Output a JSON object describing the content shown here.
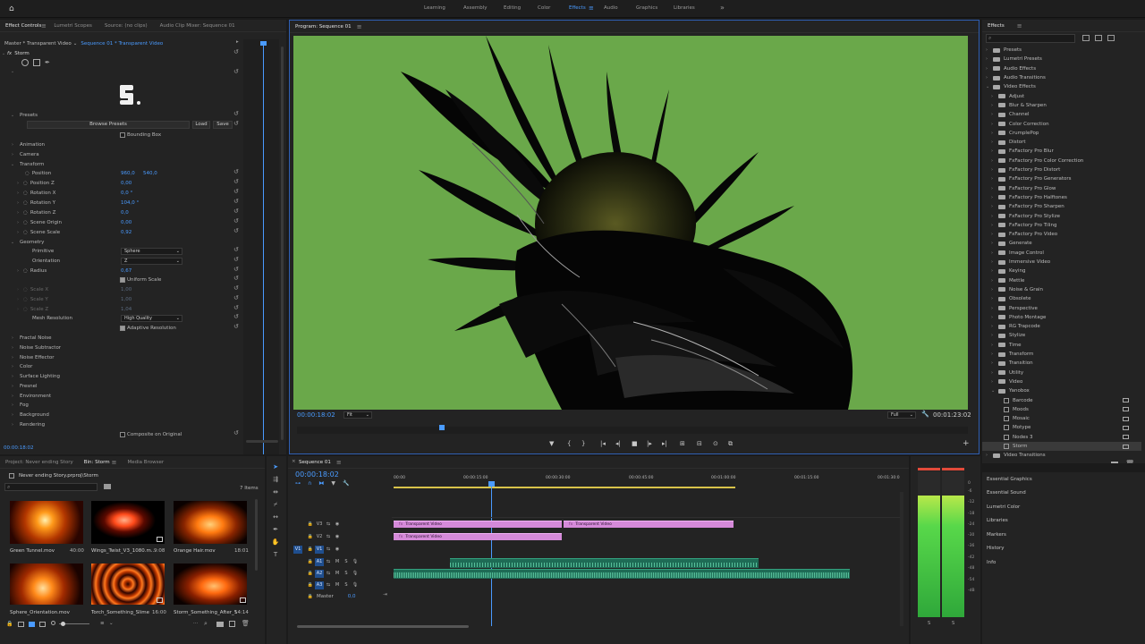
{
  "workspaces": [
    "Learning",
    "Assembly",
    "Editing",
    "Color",
    "Effects",
    "Audio",
    "Graphics",
    "Libraries"
  ],
  "workspaces_overflow": "»",
  "effect_controls": {
    "tabs": [
      "Effect Controls",
      "Lumetri Scopes",
      "Source: (no clips)",
      "Audio Clip Mixer: Sequence 01"
    ],
    "hamb": "≡",
    "master_label": "Master * Transparent Video",
    "sequence_label": "Sequence 01 * Transparent Video",
    "fx_label": "fx",
    "effect_name": "Storm",
    "presets_label": "Presets",
    "browse_presets": "Browse Presets",
    "load": "Load",
    "save": "Save",
    "bounding_box": "Bounding Box",
    "animation": "Animation",
    "camera": "Camera",
    "transform": "Transform",
    "position": "Position",
    "position_x": "960,0",
    "position_y": "540,0",
    "position_z": "Position Z",
    "position_z_val": "0,00",
    "rotation_x": "Rotation X",
    "rotation_x_val": "0,0 °",
    "rotation_y": "Rotation Y",
    "rotation_y_val": "104,0 °",
    "rotation_z": "Rotation Z",
    "rotation_z_val": "0,0",
    "scene_origin": "Scene Origin",
    "scene_origin_val": "0,00",
    "scene_scale": "Scene Scale",
    "scene_scale_val": "0,92",
    "geometry": "Geometry",
    "primitive": "Primitive",
    "primitive_val": "Sphere",
    "orientation": "Orientation",
    "orientation_val": "Z",
    "radius": "Radius",
    "radius_val": "0,67",
    "uniform_scale": "Uniform Scale",
    "scale_x": "Scale X",
    "scale_x_val": "1,00",
    "scale_y": "Scale Y",
    "scale_y_val": "1,00",
    "scale_z": "Scale Z",
    "scale_z_val": "1,04",
    "mesh_resolution": "Mesh Resolution",
    "mesh_resolution_val": "High Quality",
    "adaptive_resolution": "Adaptive Resolution",
    "groups": [
      "Fractal Noise",
      "Noise Subtractor",
      "Noise Effector",
      "Color",
      "Surface Lighting",
      "Fresnel",
      "Environment",
      "Fog",
      "Background",
      "Rendering"
    ],
    "composite": "Composite on Original",
    "timecode": "00:00:18:02"
  },
  "program": {
    "title": "Program: Sequence 01",
    "timecode": "00:00:18:02",
    "fit": "Fit",
    "quality": "Full",
    "duration": "00:01:23:02"
  },
  "effects_panel": {
    "title": "Effects",
    "items": [
      {
        "label": "Presets",
        "level": 0,
        "kind": "folder",
        "open": false
      },
      {
        "label": "Lumetri Presets",
        "level": 0,
        "kind": "folder",
        "open": false
      },
      {
        "label": "Audio Effects",
        "level": 0,
        "kind": "folder",
        "open": false
      },
      {
        "label": "Audio Transitions",
        "level": 0,
        "kind": "folder",
        "open": false
      },
      {
        "label": "Video Effects",
        "level": 0,
        "kind": "folder",
        "open": true
      },
      {
        "label": "Adjust",
        "level": 1,
        "kind": "folder",
        "open": false
      },
      {
        "label": "Blur & Sharpen",
        "level": 1,
        "kind": "folder",
        "open": false
      },
      {
        "label": "Channel",
        "level": 1,
        "kind": "folder",
        "open": false
      },
      {
        "label": "Color Correction",
        "level": 1,
        "kind": "folder",
        "open": false
      },
      {
        "label": "CrumplePop",
        "level": 1,
        "kind": "folder",
        "open": false
      },
      {
        "label": "Distort",
        "level": 1,
        "kind": "folder",
        "open": false
      },
      {
        "label": "FxFactory Pro Blur",
        "level": 1,
        "kind": "folder",
        "open": false
      },
      {
        "label": "FxFactory Pro Color Correction",
        "level": 1,
        "kind": "folder",
        "open": false
      },
      {
        "label": "FxFactory Pro Distort",
        "level": 1,
        "kind": "folder",
        "open": false
      },
      {
        "label": "FxFactory Pro Generators",
        "level": 1,
        "kind": "folder",
        "open": false
      },
      {
        "label": "FxFactory Pro Glow",
        "level": 1,
        "kind": "folder",
        "open": false
      },
      {
        "label": "FxFactory Pro Halftones",
        "level": 1,
        "kind": "folder",
        "open": false
      },
      {
        "label": "FxFactory Pro Sharpen",
        "level": 1,
        "kind": "folder",
        "open": false
      },
      {
        "label": "FxFactory Pro Stylize",
        "level": 1,
        "kind": "folder",
        "open": false
      },
      {
        "label": "FxFactory Pro Tiling",
        "level": 1,
        "kind": "folder",
        "open": false
      },
      {
        "label": "FxFactory Pro Video",
        "level": 1,
        "kind": "folder",
        "open": false
      },
      {
        "label": "Generate",
        "level": 1,
        "kind": "folder",
        "open": false
      },
      {
        "label": "Image Control",
        "level": 1,
        "kind": "folder",
        "open": false
      },
      {
        "label": "Immersive Video",
        "level": 1,
        "kind": "folder",
        "open": false
      },
      {
        "label": "Keying",
        "level": 1,
        "kind": "folder",
        "open": false
      },
      {
        "label": "Mettle",
        "level": 1,
        "kind": "folder",
        "open": false
      },
      {
        "label": "Noise & Grain",
        "level": 1,
        "kind": "folder",
        "open": false
      },
      {
        "label": "Obsolete",
        "level": 1,
        "kind": "folder",
        "open": false
      },
      {
        "label": "Perspective",
        "level": 1,
        "kind": "folder",
        "open": false
      },
      {
        "label": "Photo Montage",
        "level": 1,
        "kind": "folder",
        "open": false
      },
      {
        "label": "RG Trapcode",
        "level": 1,
        "kind": "folder",
        "open": false
      },
      {
        "label": "Stylize",
        "level": 1,
        "kind": "folder",
        "open": false
      },
      {
        "label": "Time",
        "level": 1,
        "kind": "folder",
        "open": false
      },
      {
        "label": "Transform",
        "level": 1,
        "kind": "folder",
        "open": false
      },
      {
        "label": "Transition",
        "level": 1,
        "kind": "folder",
        "open": false
      },
      {
        "label": "Utility",
        "level": 1,
        "kind": "folder",
        "open": false
      },
      {
        "label": "Video",
        "level": 1,
        "kind": "folder",
        "open": false
      },
      {
        "label": "Yanobox",
        "level": 1,
        "kind": "folder",
        "open": true
      },
      {
        "label": "Barcode",
        "level": 2,
        "kind": "effect",
        "open": false
      },
      {
        "label": "Moods",
        "level": 2,
        "kind": "effect",
        "open": false
      },
      {
        "label": "Mosaic",
        "level": 2,
        "kind": "effect",
        "open": false
      },
      {
        "label": "Motype",
        "level": 2,
        "kind": "effect",
        "open": false
      },
      {
        "label": "Nodes 3",
        "level": 2,
        "kind": "effect",
        "open": false
      },
      {
        "label": "Storm",
        "level": 2,
        "kind": "effect",
        "open": false,
        "selected": true
      },
      {
        "label": "Video Transitions",
        "level": 0,
        "kind": "folder",
        "open": false
      }
    ],
    "side_panels": [
      "Essential Graphics",
      "Essential Sound",
      "Lumetri Color",
      "Libraries",
      "Markers",
      "History",
      "Info"
    ]
  },
  "project": {
    "tabs": [
      "Project: Never ending Story",
      "Bin: Storm",
      "Media Browser"
    ],
    "path": "Never ending Story.prproj\\Storm",
    "count": "7 Items",
    "clips": [
      {
        "name": "Green Tunnel.mov",
        "dur": "40:00"
      },
      {
        "name": "Wings_Twist_V3_1080.m...",
        "dur": "9:08"
      },
      {
        "name": "Orange Hair.mov",
        "dur": "18:01"
      },
      {
        "name": "Sphere_Orientation.mov",
        "dur": ""
      },
      {
        "name": "Torch_Something_Slime",
        "dur": "16:00"
      },
      {
        "name": "Storm_Something_After_5",
        "dur": "14:14"
      }
    ]
  },
  "timeline": {
    "tab": "Sequence 01",
    "timecode": "00:00:18:02",
    "ruler": [
      "00:00",
      "00:00:15:00",
      "00:00:30:00",
      "00:00:45:00",
      "00:01:00:00",
      "00:01:15:00",
      "00:01:30:0"
    ],
    "tracks": [
      {
        "name": "V3",
        "kind": "video"
      },
      {
        "name": "V2",
        "kind": "video"
      },
      {
        "name": "V1",
        "kind": "video",
        "active": true
      },
      {
        "name": "A1",
        "kind": "audio"
      },
      {
        "name": "A2",
        "kind": "audio"
      },
      {
        "name": "A3",
        "kind": "audio"
      }
    ],
    "src_v": "V1",
    "master": "Master",
    "master_val": "0,0",
    "clip_label": "Transparent Video",
    "mute": "M",
    "solo": "S"
  },
  "meters": {
    "scale": [
      "0",
      "-6",
      "-12",
      "-18",
      "-24",
      "-30",
      "-36",
      "-42",
      "-48",
      "-54",
      "-dB"
    ],
    "footer": [
      "S",
      "S"
    ]
  },
  "colors": {
    "accent": "#4a9bff",
    "green_screen": "#6aa84a",
    "video_clip": "#d58ad9",
    "audio_clip": "#1e6b55"
  }
}
